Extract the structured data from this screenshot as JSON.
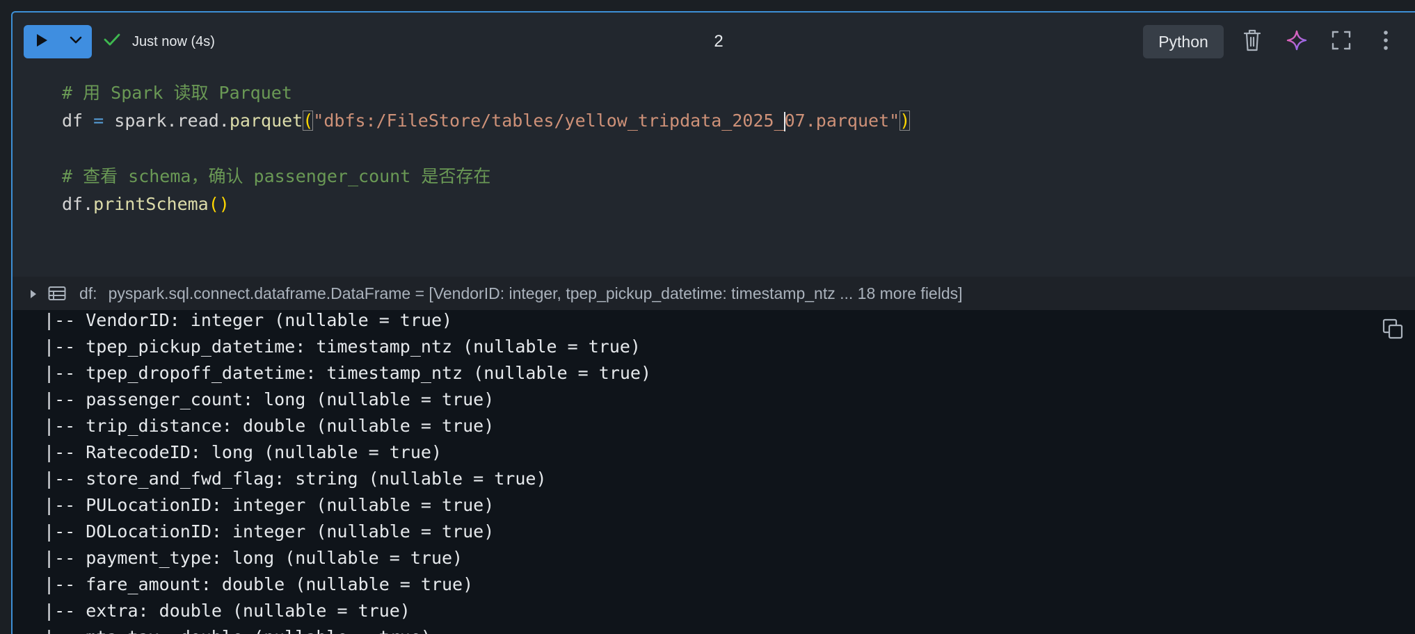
{
  "toolbar": {
    "run_icon": "play-icon",
    "run_menu_icon": "chevron-down-icon",
    "status_icon": "checkmark-icon",
    "status_text": "Just now (4s)",
    "cell_number": "2",
    "language": "Python",
    "delete_icon": "trash-icon",
    "assistant_icon": "sparkle-icon",
    "fullscreen_icon": "expand-icon",
    "more_icon": "kebab-menu-icon"
  },
  "code": {
    "line1_comment": "# 用 Spark 读取 Parquet",
    "line2": {
      "var": "df",
      "op": "=",
      "obj": "spark.read.",
      "fn": "parquet",
      "open_paren": "(",
      "str_before_caret": "\"dbfs:/FileStore/tables/yellow_tripdata_2025_",
      "str_after_caret": "07.parquet\"",
      "close_paren": ")"
    },
    "line4_comment": "# 查看 schema，确认 passenger_count 是否存在",
    "line5": {
      "obj": "df.",
      "fn": "printSchema",
      "parens": "()"
    }
  },
  "dataframe_bar": {
    "expand_icon": "triangle-right-icon",
    "table_icon": "table-icon",
    "name": "df:",
    "type_info": "pyspark.sql.connect.dataframe.DataFrame = [VendorID: integer, tpep_pickup_datetime: timestamp_ntz ... 18 more fields]"
  },
  "output": {
    "copy_icon": "copy-icon",
    "lines": [
      " |-- VendorID: integer (nullable = true)",
      " |-- tpep_pickup_datetime: timestamp_ntz (nullable = true)",
      " |-- tpep_dropoff_datetime: timestamp_ntz (nullable = true)",
      " |-- passenger_count: long (nullable = true)",
      " |-- trip_distance: double (nullable = true)",
      " |-- RatecodeID: long (nullable = true)",
      " |-- store_and_fwd_flag: string (nullable = true)",
      " |-- PULocationID: integer (nullable = true)",
      " |-- DOLocationID: integer (nullable = true)",
      " |-- payment_type: long (nullable = true)",
      " |-- fare_amount: double (nullable = true)",
      " |-- extra: double (nullable = true)",
      " |-- mta_tax: double (nullable = true)"
    ]
  },
  "colors": {
    "run_button": "#3f8ee0",
    "cell_border": "#3d8fd6",
    "comment": "#6a9955",
    "string": "#ce9178",
    "function": "#dcdcaa",
    "operator": "#569cd6",
    "bracket": "#ffd700",
    "status_check": "#3fb950",
    "sparkle": "#a970ff"
  }
}
